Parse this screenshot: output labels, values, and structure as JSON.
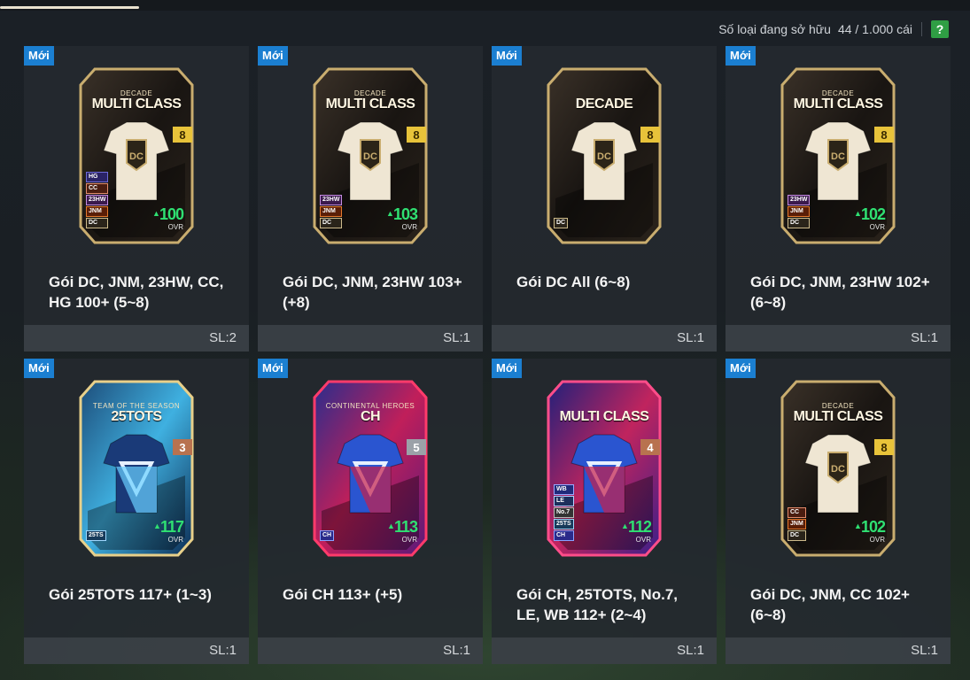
{
  "header": {
    "owned_label": "Số loại đang sở hữu",
    "owned_value": "44 / 1.000 cái",
    "help_label": "?"
  },
  "packs": [
    {
      "badge": "Mới",
      "card_style": "dc",
      "title_small": "DECADE",
      "title_main": "MULTI CLASS",
      "level": "8",
      "level_color": "gold",
      "tags": [
        "HG",
        "CC",
        "23HW",
        "JNM",
        "DC"
      ],
      "ovr": "100",
      "ovr_label": "OVR",
      "name": "Gói DC, JNM, 23HW, CC, HG 100+ (5~8)",
      "qty": "SL:2"
    },
    {
      "badge": "Mới",
      "card_style": "dc",
      "title_small": "DECADE",
      "title_main": "MULTI CLASS",
      "level": "8",
      "level_color": "gold",
      "tags": [
        "23HW",
        "JNM",
        "DC"
      ],
      "ovr": "103",
      "ovr_label": "OVR",
      "name": "Gói DC, JNM, 23HW 103+ (+8)",
      "qty": "SL:1"
    },
    {
      "badge": "Mới",
      "card_style": "dc",
      "title_small": "",
      "title_main": "DECADE",
      "level": "8",
      "level_color": "gold",
      "tags": [
        "DC"
      ],
      "ovr": "",
      "ovr_label": "",
      "name": "Gói DC All (6~8)",
      "qty": "SL:1"
    },
    {
      "badge": "Mới",
      "card_style": "dc",
      "title_small": "DECADE",
      "title_main": "MULTI CLASS",
      "level": "8",
      "level_color": "gold",
      "tags": [
        "23HW",
        "JNM",
        "DC"
      ],
      "ovr": "102",
      "ovr_label": "OVR",
      "name": "Gói DC, JNM, 23HW 102+ (6~8)",
      "qty": "SL:1"
    },
    {
      "badge": "Mới",
      "card_style": "tots",
      "title_small": "TEAM OF THE SEASON",
      "title_main": "25TOTS",
      "level": "3",
      "level_color": "copper",
      "tags": [
        "25TS"
      ],
      "ovr": "117",
      "ovr_label": "OVR",
      "name": "Gói 25TOTS 117+ (1~3)",
      "qty": "SL:1"
    },
    {
      "badge": "Mới",
      "card_style": "ch",
      "title_small": "CONTINENTAL HEROES",
      "title_main": "CH",
      "level": "5",
      "level_color": "silver",
      "tags": [
        "CH"
      ],
      "ovr": "113",
      "ovr_label": "OVR",
      "name": "Gói CH 113+ (+5)",
      "qty": "SL:1"
    },
    {
      "badge": "Mới",
      "card_style": "mc",
      "title_small": "",
      "title_main": "MULTI CLASS",
      "level": "4",
      "level_color": "copper",
      "tags": [
        "WB",
        "LE",
        "No.7",
        "25TS",
        "CH"
      ],
      "ovr": "112",
      "ovr_label": "OVR",
      "name": "Gói CH, 25TOTS, No.7, LE, WB 112+ (2~4)",
      "qty": "SL:1"
    },
    {
      "badge": "Mới",
      "card_style": "dc",
      "title_small": "DECADE",
      "title_main": "MULTI CLASS",
      "level": "8",
      "level_color": "gold",
      "tags": [
        "CC",
        "JNM",
        "DC"
      ],
      "ovr": "102",
      "ovr_label": "OVR",
      "name": "Gói DC, JNM, CC 102+ (6~8)",
      "qty": "SL:1"
    }
  ],
  "colors": {
    "new_badge": "#1b7fd1",
    "ovr": "#2fe072",
    "help": "#2f9e44"
  }
}
